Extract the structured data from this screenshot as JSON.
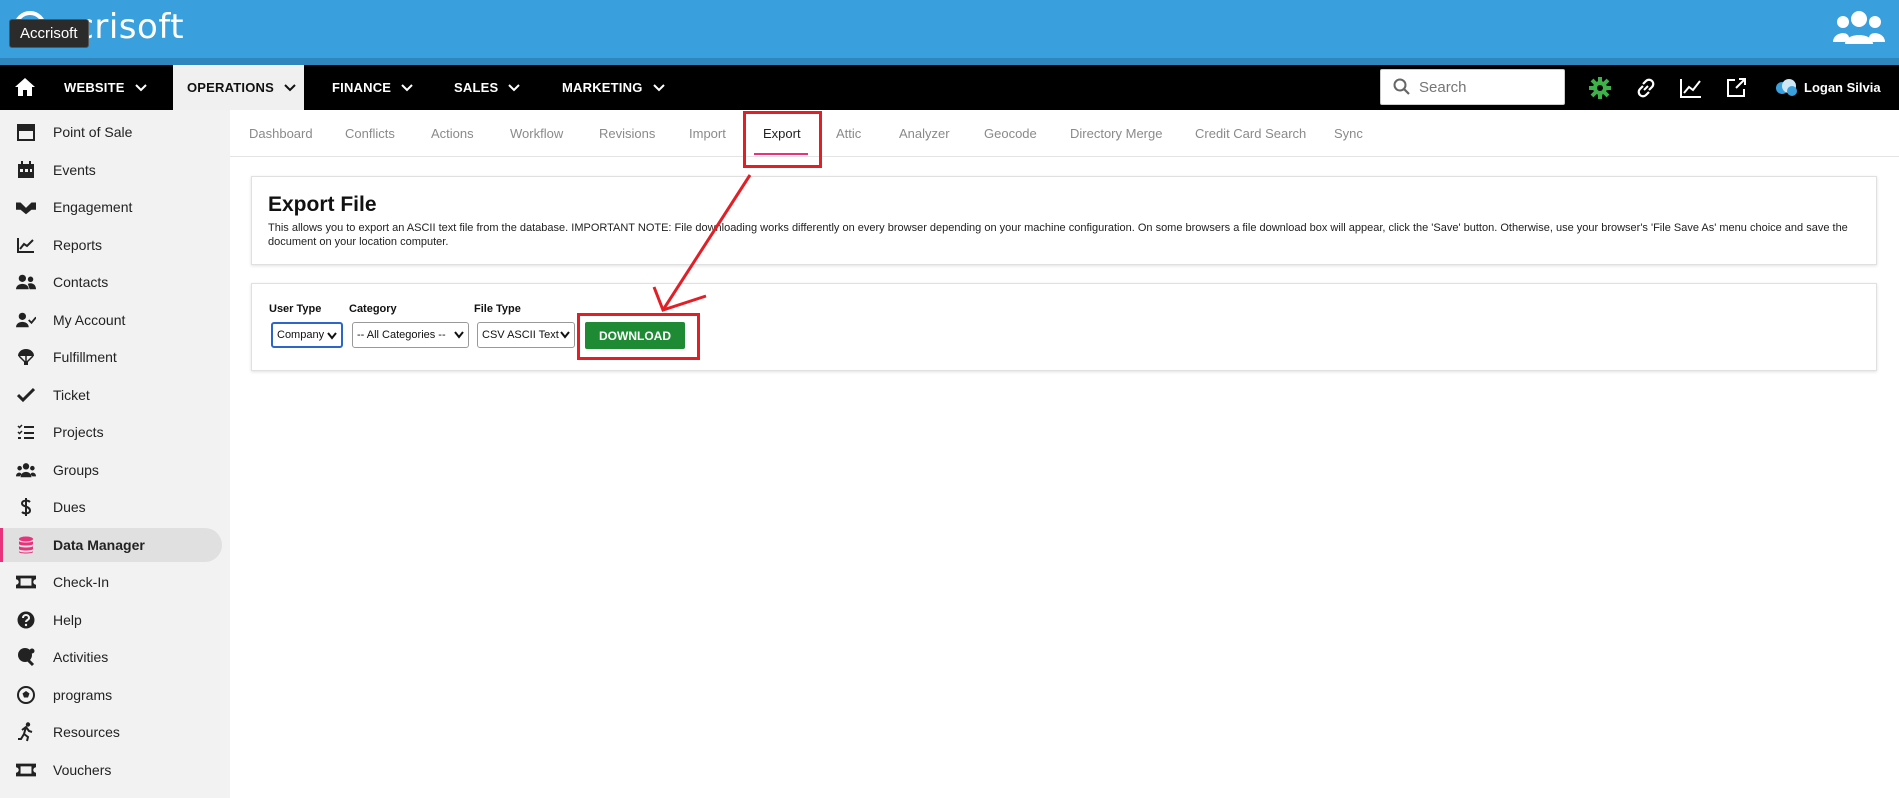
{
  "header": {
    "logo_text": "ccrisoft",
    "tooltip": "Accrisoft",
    "users_icon": "users-icon"
  },
  "nav": {
    "home_icon": "home-icon",
    "items": [
      {
        "label": "WEBSITE",
        "active": false
      },
      {
        "label": "OPERATIONS",
        "active": true
      },
      {
        "label": "FINANCE",
        "active": false
      },
      {
        "label": "SALES",
        "active": false
      },
      {
        "label": "MARKETING",
        "active": false
      }
    ],
    "search_placeholder": "Search",
    "tools": [
      "gear-icon",
      "link-icon",
      "chart-line-icon",
      "external-link-icon"
    ],
    "user_name": "Logan Silvia",
    "colors": {
      "bar": "#000000",
      "gear": "#3fb14a"
    }
  },
  "sidebar": {
    "items": [
      {
        "label": "Point of Sale",
        "icon": "store-icon"
      },
      {
        "label": "Events",
        "icon": "calendar-icon"
      },
      {
        "label": "Engagement",
        "icon": "handshake-icon"
      },
      {
        "label": "Reports",
        "icon": "chart-line-icon"
      },
      {
        "label": "Contacts",
        "icon": "users-icon"
      },
      {
        "label": "My Account",
        "icon": "user-check-icon"
      },
      {
        "label": "Fulfillment",
        "icon": "parachute-icon"
      },
      {
        "label": "Ticket",
        "icon": "check-icon"
      },
      {
        "label": "Projects",
        "icon": "task-list-icon"
      },
      {
        "label": "Groups",
        "icon": "group-icon"
      },
      {
        "label": "Dues",
        "icon": "dollar-icon"
      },
      {
        "label": "Data Manager",
        "icon": "database-icon",
        "active": true
      },
      {
        "label": "Check-In",
        "icon": "ticket-icon"
      },
      {
        "label": "Help",
        "icon": "question-icon"
      },
      {
        "label": "Activities",
        "icon": "ping-pong-icon"
      },
      {
        "label": "programs",
        "icon": "soccer-ball-icon"
      },
      {
        "label": "Resources",
        "icon": "running-icon"
      },
      {
        "label": "Vouchers",
        "icon": "voucher-icon"
      }
    ]
  },
  "tabs": [
    {
      "label": "Dashboard"
    },
    {
      "label": "Conflicts"
    },
    {
      "label": "Actions"
    },
    {
      "label": "Workflow"
    },
    {
      "label": "Revisions"
    },
    {
      "label": "Import"
    },
    {
      "label": "Export",
      "active": true
    },
    {
      "label": "Attic"
    },
    {
      "label": "Analyzer"
    },
    {
      "label": "Geocode"
    },
    {
      "label": "Directory Merge"
    },
    {
      "label": "Credit Card Search"
    },
    {
      "label": "Sync"
    }
  ],
  "export_card": {
    "title": "Export File",
    "description": "This allows you to export an ASCII text file from the database. IMPORTANT NOTE: File downloading works differently on every browser depending on your machine configuration. On some browsers a file download box will appear, click the 'Save' button. Otherwise, use your browser's 'File Save As' menu choice and save the document on your location computer."
  },
  "form": {
    "user_type_label": "User Type",
    "user_type_value": "Company",
    "category_label": "Category",
    "category_value": "-- All Categories --",
    "file_type_label": "File Type",
    "file_type_value": "CSV ASCII Text",
    "download_label": "DOWNLOAD",
    "download_color": "#1e8a33"
  },
  "annotation_color": "#e21f26"
}
